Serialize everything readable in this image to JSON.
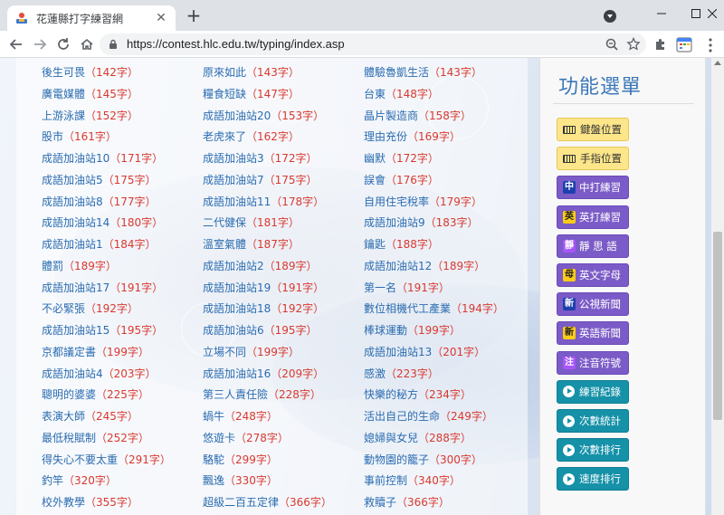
{
  "browser": {
    "tab_title": "花蓮縣打字練習網",
    "tab_close_glyph": "✕",
    "new_tab_glyph": "+",
    "url": "https://contest.hlc.edu.tw/typing/index.asp",
    "icons": [
      "favicon-icon",
      "close-icon",
      "plus-icon",
      "profile-icon",
      "minimize-icon",
      "maximize-icon",
      "window-close-icon",
      "back-arrow-icon",
      "forward-arrow-icon",
      "reload-icon",
      "home-icon",
      "lock-icon",
      "zoom-icon",
      "star-icon",
      "puzzle-icon",
      "calendar-icon",
      "kebab-menu-icon"
    ]
  },
  "word_columns": [
    [
      {
        "name": "後生可畏",
        "count": "（142字）"
      },
      {
        "name": "廣電媒體",
        "count": "（145字）"
      },
      {
        "name": "上游泳課",
        "count": "（152字）"
      },
      {
        "name": "股市",
        "count": "（161字）"
      },
      {
        "name": "成語加油站10",
        "count": "（171字）"
      },
      {
        "name": "成語加油站5",
        "count": "（175字）"
      },
      {
        "name": "成語加油站8",
        "count": "（177字）"
      },
      {
        "name": "成語加油站14",
        "count": "（180字）"
      },
      {
        "name": "成語加油站1",
        "count": "（184字）"
      },
      {
        "name": "體罰",
        "count": "（189字）"
      },
      {
        "name": "成語加油站17",
        "count": "（191字）"
      },
      {
        "name": "不必緊張",
        "count": "（192字）"
      },
      {
        "name": "成語加油站15",
        "count": "（195字）"
      },
      {
        "name": "京都議定書",
        "count": "（199字）"
      },
      {
        "name": "成語加油站4",
        "count": "（203字）"
      },
      {
        "name": "聰明的婆婆",
        "count": "（225字）"
      },
      {
        "name": "表演大師",
        "count": "（245字）"
      },
      {
        "name": "最低稅賦制",
        "count": "（252字）"
      },
      {
        "name": "得失心不要太重",
        "count": "（291字）"
      },
      {
        "name": "釣竿",
        "count": "（320字）"
      },
      {
        "name": "校外教學",
        "count": "（355字）"
      }
    ],
    [
      {
        "name": "原來如此",
        "count": "（143字）"
      },
      {
        "name": "糧食短缺",
        "count": "（147字）"
      },
      {
        "name": "成語加油站20",
        "count": "（153字）"
      },
      {
        "name": "老虎來了",
        "count": "（162字）"
      },
      {
        "name": "成語加油站3",
        "count": "（172字）"
      },
      {
        "name": "成語加油站7",
        "count": "（175字）"
      },
      {
        "name": "成語加油站11",
        "count": "（178字）"
      },
      {
        "name": "二代健保",
        "count": "（181字）"
      },
      {
        "name": "溫室氣體",
        "count": "（187字）"
      },
      {
        "name": "成語加油站2",
        "count": "（189字）"
      },
      {
        "name": "成語加油站19",
        "count": "（191字）"
      },
      {
        "name": "成語加油站18",
        "count": "（192字）"
      },
      {
        "name": "成語加油站6",
        "count": "（195字）"
      },
      {
        "name": "立場不同",
        "count": "（199字）"
      },
      {
        "name": "成語加油站16",
        "count": "（209字）"
      },
      {
        "name": "第三人責任險",
        "count": "（228字）"
      },
      {
        "name": "蝸牛",
        "count": "（248字）"
      },
      {
        "name": "悠遊卡",
        "count": "（278字）"
      },
      {
        "name": "駱駝",
        "count": "（299字）"
      },
      {
        "name": "飄逸",
        "count": "（330字）"
      },
      {
        "name": "超級二百五定律",
        "count": "（366字）"
      }
    ],
    [
      {
        "name": "體驗魯凱生活",
        "count": "（143字）"
      },
      {
        "name": "台東",
        "count": "（148字）"
      },
      {
        "name": "晶片製造商",
        "count": "（158字）"
      },
      {
        "name": "理由充份",
        "count": "（169字）"
      },
      {
        "name": "幽默",
        "count": "（172字）"
      },
      {
        "name": "誤會",
        "count": "（176字）"
      },
      {
        "name": "自用住宅稅率",
        "count": "（179字）"
      },
      {
        "name": "成語加油站9",
        "count": "（183字）"
      },
      {
        "name": "鑰匙",
        "count": "（188字）"
      },
      {
        "name": "成語加油站12",
        "count": "（189字）"
      },
      {
        "name": "第一名",
        "count": "（191字）"
      },
      {
        "name": "數位相機代工產業",
        "count": "（194字）"
      },
      {
        "name": "棒球運動",
        "count": "（199字）"
      },
      {
        "name": "成語加油站13",
        "count": "（201字）"
      },
      {
        "name": "感激",
        "count": "（223字）"
      },
      {
        "name": "快樂的秘方",
        "count": "（234字）"
      },
      {
        "name": "活出自己的生命",
        "count": "（249字）"
      },
      {
        "name": "媳婦與女兒",
        "count": "（288字）"
      },
      {
        "name": "動物園的籠子",
        "count": "（300字）"
      },
      {
        "name": "事前控制",
        "count": "（340字）"
      },
      {
        "name": "救贖子",
        "count": "（366字）"
      }
    ]
  ],
  "sidebar": {
    "title": "功能選單",
    "items": [
      {
        "label": "鍵盤位置",
        "style": "yellow",
        "icon": "keyboard-icon"
      },
      {
        "label": "手指位置",
        "style": "yellow",
        "icon": "keyboard-icon"
      },
      {
        "label": "中打練習",
        "style": "purple",
        "icon": "chinese-char-icon",
        "glyph": "中",
        "glyph_color": "blue"
      },
      {
        "label": "英打練習",
        "style": "purple",
        "icon": "english-char-icon",
        "glyph": "英",
        "glyph_color": "yellow"
      },
      {
        "label": "靜 思 語",
        "style": "purple",
        "icon": "quiet-char-icon",
        "glyph": "靜",
        "glyph_color": "purple"
      },
      {
        "label": "英文字母",
        "style": "purple",
        "icon": "alphabet-char-icon",
        "glyph": "母",
        "glyph_color": "yellow"
      },
      {
        "label": "公視新聞",
        "style": "purple",
        "icon": "news-char-icon",
        "glyph": "新",
        "glyph_color": "blue"
      },
      {
        "label": "英語新聞",
        "style": "purple",
        "icon": "news-char-icon",
        "glyph": "新",
        "glyph_color": "yellow"
      },
      {
        "label": "注音符號",
        "style": "purple",
        "icon": "phonetic-char-icon",
        "glyph": "注",
        "glyph_color": "purple"
      },
      {
        "label": "練習紀錄",
        "style": "teal",
        "icon": "play-circle-icon"
      },
      {
        "label": "次數統計",
        "style": "teal",
        "icon": "play-circle-icon"
      },
      {
        "label": "次數排行",
        "style": "teal",
        "icon": "play-circle-icon"
      },
      {
        "label": "速度排行",
        "style": "teal",
        "icon": "play-circle-icon"
      }
    ]
  },
  "colors": {
    "link_blue": "#2b6cb0",
    "count_red": "#d9382f",
    "title_blue": "#3b78b8",
    "yellow_btn": "#fde68a",
    "purple_btn": "#7b5bc7",
    "teal_btn": "#1591a8"
  }
}
